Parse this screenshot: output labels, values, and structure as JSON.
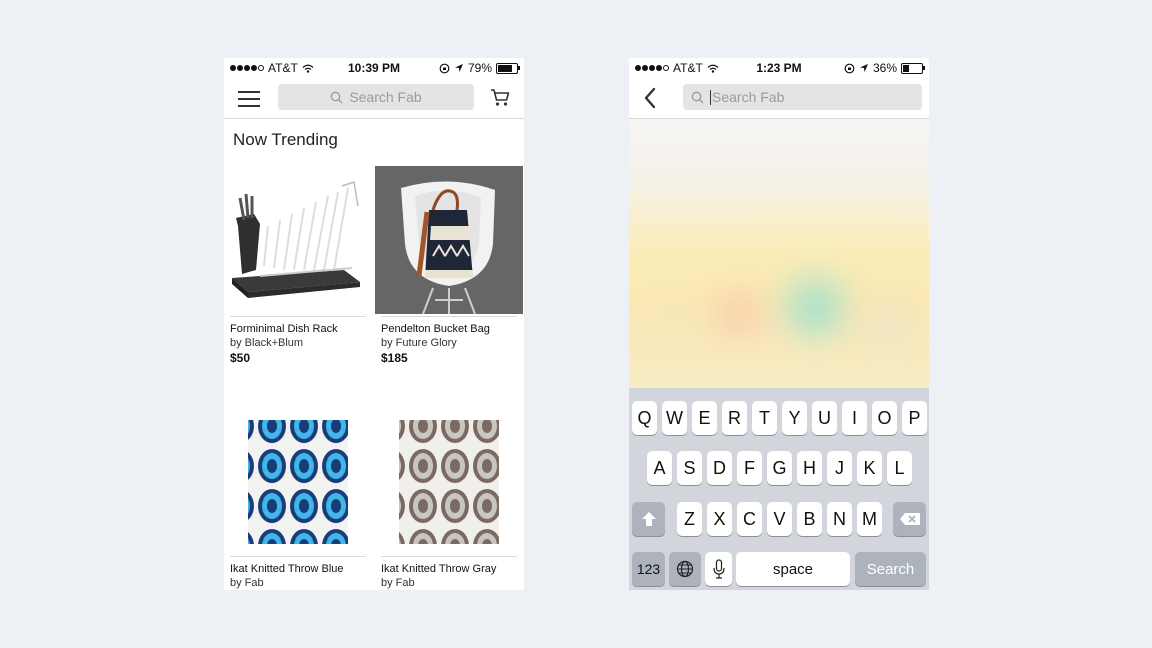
{
  "left_phone": {
    "status": {
      "carrier": "AT&T",
      "time": "10:39 PM",
      "battery": "79%",
      "battery_level": 0.79
    },
    "search": {
      "placeholder": "Search Fab"
    },
    "section_title": "Now Trending",
    "products": [
      {
        "name": "Forminimal Dish Rack",
        "brand": "by Black+Blum",
        "price": "$50"
      },
      {
        "name": "Pendelton Bucket Bag",
        "brand": "by Future Glory",
        "price": "$185"
      },
      {
        "name": "Ikat Knitted Throw Blue",
        "brand": "by Fab",
        "price": ""
      },
      {
        "name": "Ikat Knitted Throw Gray",
        "brand": "by Fab",
        "price": ""
      }
    ]
  },
  "right_phone": {
    "status": {
      "carrier": "AT&T",
      "time": "1:23 PM",
      "battery": "36%",
      "battery_level": 0.36
    },
    "search": {
      "placeholder": "Search Fab"
    },
    "keyboard": {
      "row1": [
        "Q",
        "W",
        "E",
        "R",
        "T",
        "Y",
        "U",
        "I",
        "O",
        "P"
      ],
      "row2": [
        "A",
        "S",
        "D",
        "F",
        "G",
        "H",
        "J",
        "K",
        "L"
      ],
      "row3": [
        "Z",
        "X",
        "C",
        "V",
        "B",
        "N",
        "M"
      ],
      "numbers_key": "123",
      "space_key": "space",
      "search_key": "Search"
    }
  },
  "icons": {
    "menu": "menu-icon",
    "search": "search-icon",
    "cart": "cart-icon",
    "back": "chevron-left-icon",
    "shift": "shift-icon",
    "delete": "backspace-icon",
    "globe": "globe-icon",
    "mic": "microphone-icon",
    "wifi": "wifi-icon",
    "location": "location-arrow-icon",
    "lock": "orientation-lock-icon"
  },
  "colors": {
    "background": "#edf1f5",
    "keyboard": "#d2d5db",
    "search_bg": "#e4e4e6"
  }
}
